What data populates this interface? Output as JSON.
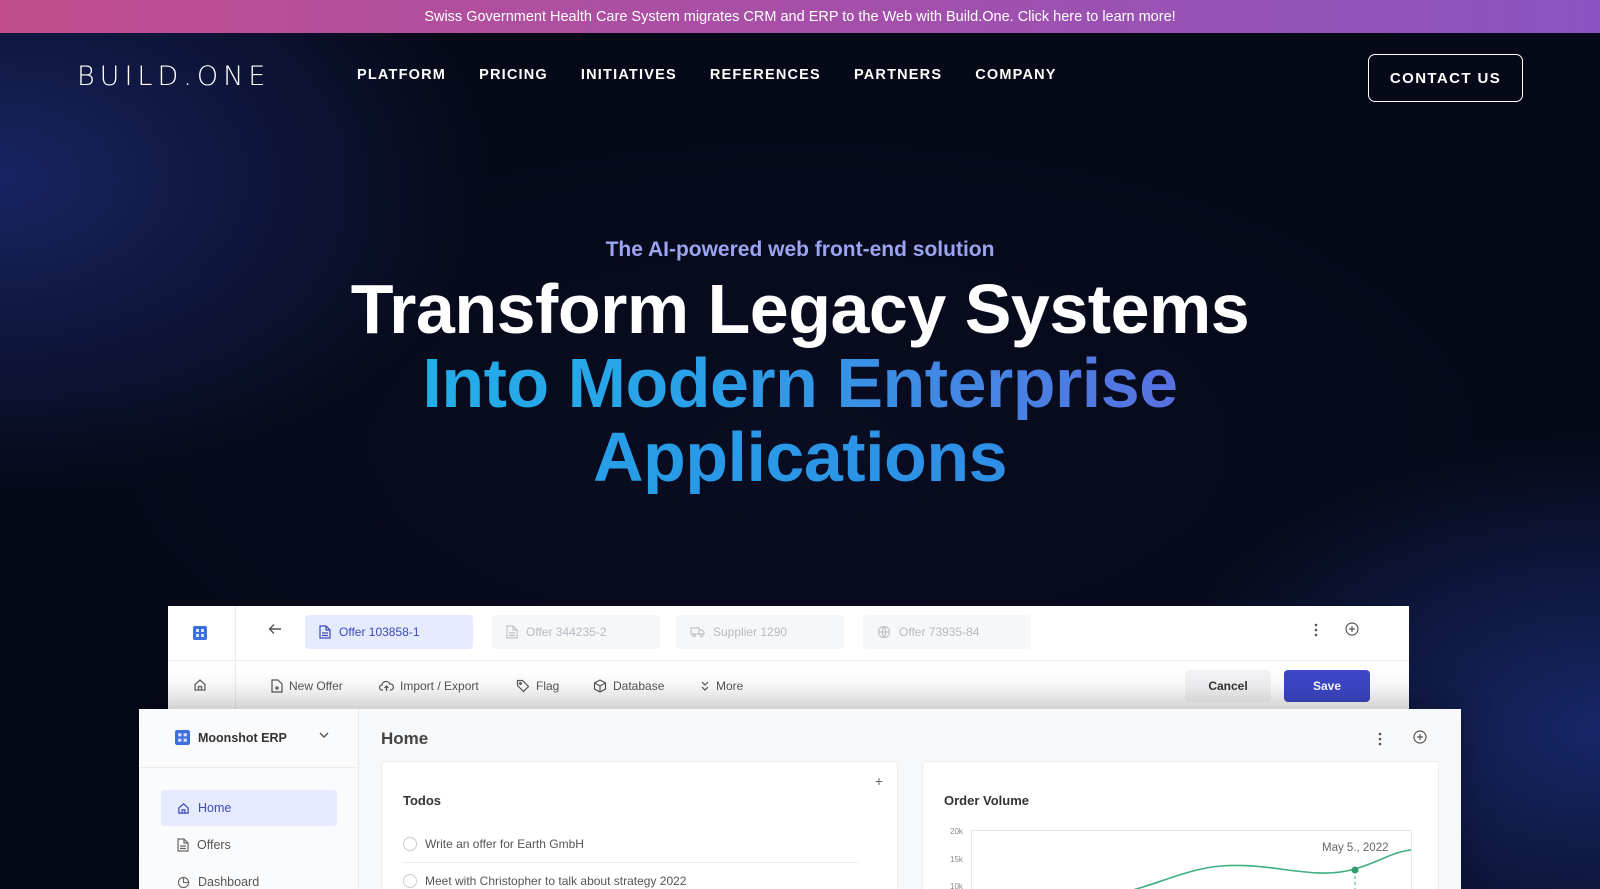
{
  "banner": {
    "text": "Swiss Government Health Care System migrates CRM and ERP to the Web with Build.One. Click here to learn more!"
  },
  "header": {
    "logo": "BUILD.ONE",
    "nav": [
      {
        "label": "PLATFORM"
      },
      {
        "label": "PRICING"
      },
      {
        "label": "INITIATIVES"
      },
      {
        "label": "REFERENCES"
      },
      {
        "label": "PARTNERS"
      },
      {
        "label": "COMPANY"
      }
    ],
    "contact_label": "CONTACT US"
  },
  "hero": {
    "eyebrow": "The AI-powered web front-end solution",
    "line1": "Transform Legacy Systems",
    "line2": "Into Modern Enterprise",
    "line3": "Applications"
  },
  "app": {
    "tabs": [
      {
        "label": "Offer 103858-1",
        "icon": "document-icon",
        "active": true
      },
      {
        "label": "Offer 344235-2",
        "icon": "document-icon",
        "active": false
      },
      {
        "label": "Supplier 1290",
        "icon": "truck-icon",
        "active": false
      },
      {
        "label": "Offer 73935-84",
        "icon": "globe-icon",
        "active": false
      }
    ],
    "toolbar": {
      "new_offer": "New Offer",
      "import_export": "Import / Export",
      "flag": "Flag",
      "database": "Database",
      "more": "More",
      "cancel": "Cancel",
      "save": "Save"
    },
    "workspace": "Moonshot ERP",
    "sidebar": [
      {
        "label": "Home",
        "icon": "home-icon",
        "active": true
      },
      {
        "label": "Offers",
        "icon": "document-icon",
        "active": false
      },
      {
        "label": "Dashboard",
        "icon": "pie-chart-icon",
        "active": false
      }
    ],
    "page_title": "Home",
    "todos": {
      "title": "Todos",
      "add": "+",
      "items": [
        "Write an offer for Earth GmbH",
        "Meet with Christopher to talk about strategy 2022"
      ]
    },
    "order_volume": {
      "title": "Order Volume",
      "y_ticks": [
        "20k",
        "15k",
        "10k"
      ],
      "highlight_label": "May 5., 2022"
    }
  },
  "colors": {
    "accent": "#3d47c7",
    "active_bg": "#e6eaff",
    "chart_line": "#3fae7f"
  }
}
